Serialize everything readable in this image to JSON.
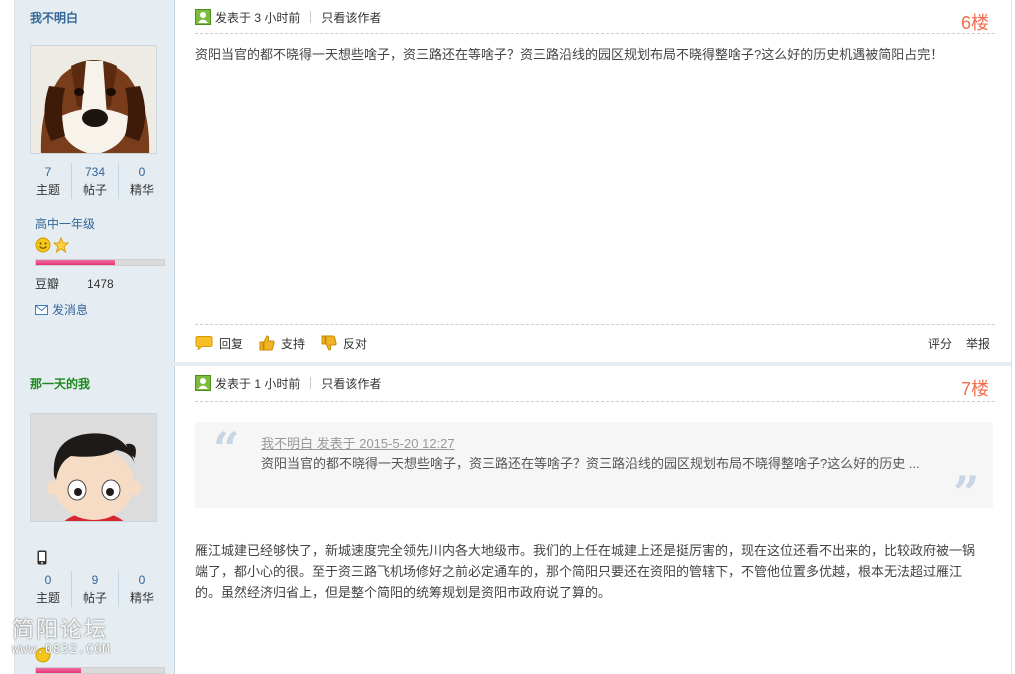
{
  "posts": [
    {
      "username": "我不明白",
      "stats": [
        {
          "num": "7",
          "label": "主题"
        },
        {
          "num": "734",
          "label": "帖子"
        },
        {
          "num": "0",
          "label": "精华"
        }
      ],
      "level": "高中一年级",
      "credit_label": "豆瓣",
      "credit_value": "1478",
      "send_message": "发消息",
      "posted": "发表于 3 小时前",
      "only_author": "只看该作者",
      "floor": "6楼",
      "content": "资阳当官的都不晓得一天想些啥子，资三路还在等啥子？资三路沿线的园区规划布局不晓得整啥子?这么好的历史机遇被简阳占完！",
      "actions": {
        "reply": "回复",
        "support": "支持",
        "oppose": "反对",
        "rate": "评分",
        "report": "举报"
      }
    },
    {
      "username": "那一天的我",
      "stats": [
        {
          "num": "0",
          "label": "主题"
        },
        {
          "num": "9",
          "label": "帖子"
        },
        {
          "num": "0",
          "label": "精华"
        }
      ],
      "posted": "发表于 1 小时前",
      "only_author": "只看该作者",
      "floor": "7楼",
      "quote": {
        "header": "我不明白 发表于 2015-5-20 12:27",
        "body": "资阳当官的都不晓得一天想些啥子，资三路还在等啥子？资三路沿线的园区规划布局不晓得整啥子?这么好的历史 ..."
      },
      "content": "雁江城建已经够快了，新城速度完全领先川内各大地级市。我们的上任在城建上还是挺厉害的，现在这位还看不出来的，比较政府被一锅端了，都小心的很。至于资三路飞机场修好之前必定通车的，那个简阳只要还在资阳的管辖下，不管他位置多优越，根本无法超过雁江的。虽然经济归省上，但是整个简阳的统筹规划是资阳市政府说了算的。"
    }
  ],
  "watermark": {
    "text": "简阳论坛",
    "url": "www.0832.COM"
  }
}
